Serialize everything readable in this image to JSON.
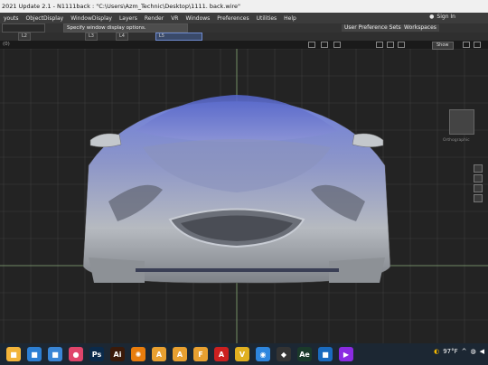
{
  "window": {
    "title": "2021 Update 2.1    - N1111back : \"C:\\Users\\Azm_Technic\\Desktop\\1111. back.wire\""
  },
  "menu": {
    "items": [
      "youts",
      "ObjectDisplay",
      "WindowDisplay",
      "Layers",
      "Render",
      "VR",
      "Windows",
      "Preferences",
      "Utilities",
      "Help"
    ],
    "sign_in": "Sign In"
  },
  "toolbar": {
    "field1": "",
    "prompt": "Specify window display options.",
    "user_prefs": "User Preference Sets",
    "workspaces": "Workspaces"
  },
  "layers": [
    "L2",
    "L3",
    "L4",
    "L5"
  ],
  "viewport": {
    "label": "(0)",
    "show_button": "Show",
    "nav_label": "Orthographic",
    "background": "#232323",
    "grid_color": "#3d3d3d",
    "axis_color": "#7a9a6a"
  },
  "taskbar": {
    "apps": [
      {
        "icon": "file-explorer-icon",
        "glyph": "■",
        "color": "#f2b43a"
      },
      {
        "icon": "store-icon",
        "glyph": "■",
        "color": "#2d7fd3"
      },
      {
        "icon": "mail-icon",
        "glyph": "■",
        "color": "#3a86d6"
      },
      {
        "icon": "camera-icon",
        "glyph": "●",
        "color": "#e0456b"
      },
      {
        "icon": "photoshop-icon",
        "glyph": "Ps",
        "color": "#0b2a4a"
      },
      {
        "icon": "illustrator-icon",
        "glyph": "Ai",
        "color": "#3a1a0a"
      },
      {
        "icon": "blender-icon",
        "glyph": "✺",
        "color": "#e87d0d"
      },
      {
        "icon": "alias-icon",
        "glyph": "A",
        "color": "#e8a030"
      },
      {
        "icon": "alias-active-icon",
        "glyph": "A",
        "color": "#e8a030"
      },
      {
        "icon": "f-app-icon",
        "glyph": "F",
        "color": "#e8a030"
      },
      {
        "icon": "a-red-app-icon",
        "glyph": "A",
        "color": "#cc2020"
      },
      {
        "icon": "v-app-icon",
        "glyph": "V",
        "color": "#e0b020"
      },
      {
        "icon": "chrome-icon",
        "glyph": "◉",
        "color": "#2e86de"
      },
      {
        "icon": "unity-icon",
        "glyph": "◆",
        "color": "#333"
      },
      {
        "icon": "adobe-media-icon",
        "glyph": "Ae",
        "color": "#1a3a2a"
      },
      {
        "icon": "folder-icon",
        "glyph": "■",
        "color": "#1a6bbf"
      },
      {
        "icon": "media-player-icon",
        "glyph": "▶",
        "color": "#8a2be2"
      },
      {
        "icon": "weather-icon",
        "glyph": "◐",
        "color": "#f5b800"
      }
    ],
    "temperature": "97°F"
  }
}
